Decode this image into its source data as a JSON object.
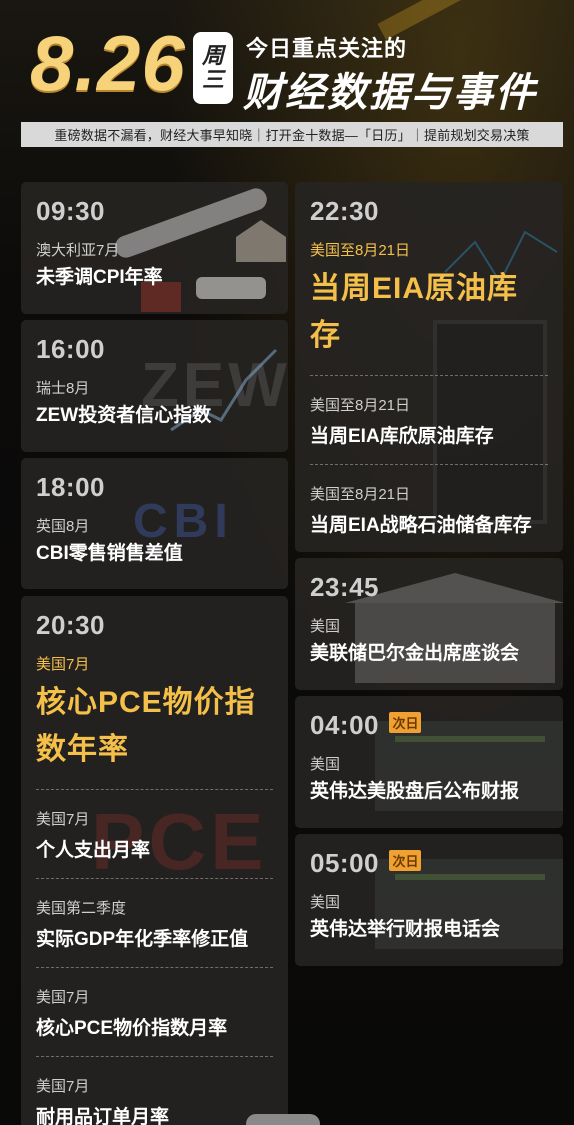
{
  "header": {
    "date": "8.26",
    "weekday_top": "周",
    "weekday_bottom": "三",
    "title_small": "今日重点关注的",
    "title_large": "财经数据与事件",
    "subline": "重磅数据不漏看，财经大事早知晓｜打开金十数据—「日历」｜提前规划交易决策"
  },
  "left_column": [
    {
      "time": "09:30",
      "region": "澳大利亚7月",
      "event": "未季调CPI年率",
      "art_text": ""
    },
    {
      "time": "16:00",
      "region": "瑞士8月",
      "event": "ZEW投资者信心指数",
      "art_text": "ZEW"
    },
    {
      "time": "18:00",
      "region": "英国8月",
      "event": "CBI零售销售差值",
      "art_text": "CBI"
    },
    {
      "time": "20:30",
      "region": "美国7月",
      "event": "核心PCE物价指数年率",
      "art_text": "PCE",
      "subs": [
        {
          "region": "美国7月",
          "event": "个人支出月率"
        },
        {
          "region": "美国第二季度",
          "event": "实际GDP年化季率修正值"
        },
        {
          "region": "美国7月",
          "event": "核心PCE物价指数月率"
        },
        {
          "region": "美国7月",
          "event": "耐用品订单月率"
        }
      ]
    }
  ],
  "right_column": [
    {
      "time": "22:30",
      "region": "美国至8月21日",
      "event": "当周EIA原油库存",
      "subs": [
        {
          "region": "美国至8月21日",
          "event": "当周EIA库欣原油库存"
        },
        {
          "region": "美国至8月21日",
          "event": "当周EIA战略石油储备库存"
        }
      ]
    },
    {
      "time": "23:45",
      "region": "美国",
      "event": "美联储巴尔金出席座谈会",
      "badge": ""
    },
    {
      "time": "04:00",
      "region": "美国",
      "event": "英伟达美股盘后公布财报",
      "badge": "次日"
    },
    {
      "time": "05:00",
      "region": "美国",
      "event": "英伟达举行财报电话会",
      "badge": "次日"
    }
  ],
  "colors": {
    "accent": "#f5c049",
    "badge_bg": "#f0a132",
    "card_bg": "#262422"
  }
}
